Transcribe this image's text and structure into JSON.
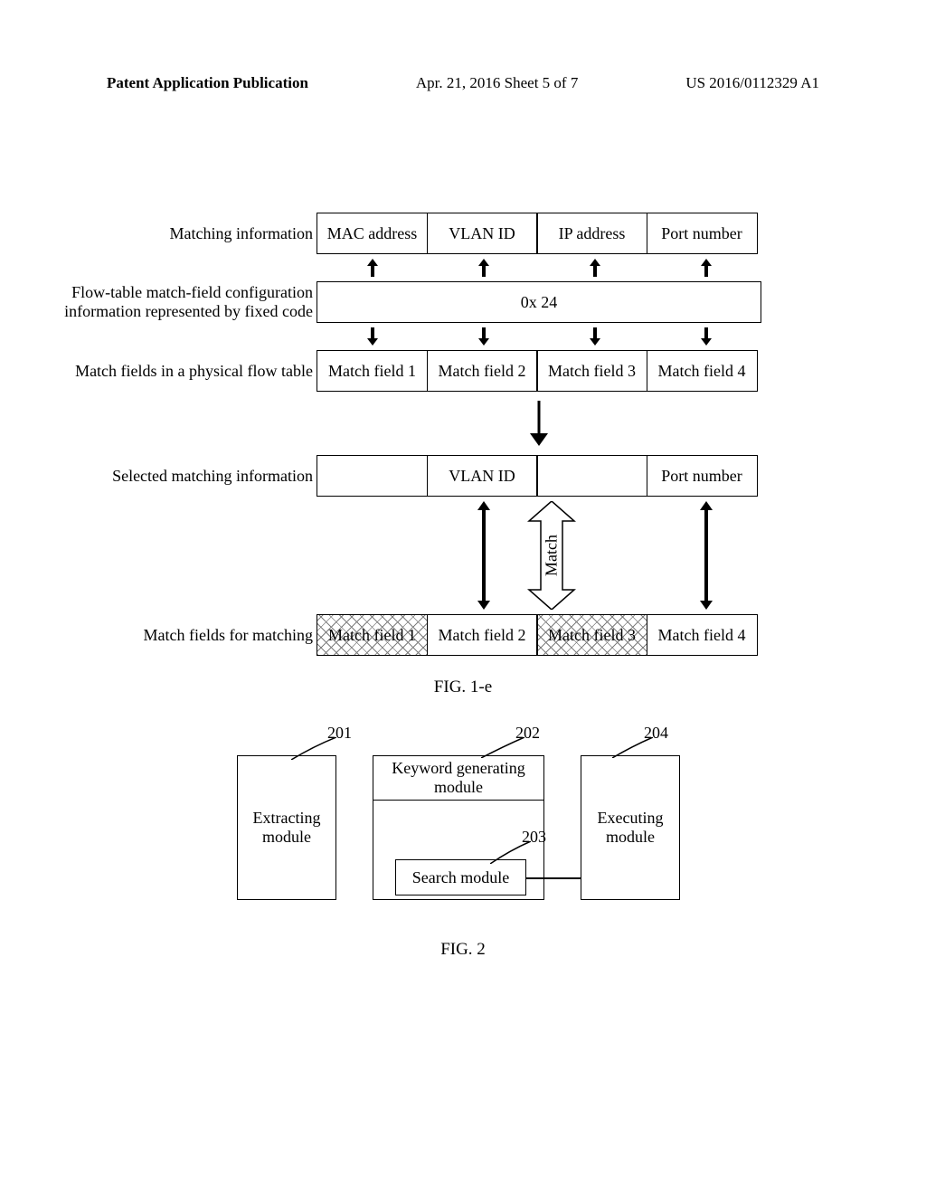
{
  "header": {
    "left": "Patent Application Publication",
    "center": "Apr. 21, 2016  Sheet 5 of 7",
    "right": "US 2016/0112329 A1"
  },
  "fig1e": {
    "labels": {
      "matching_info": "Matching information",
      "config_info": "Flow-table match-field configuration information represented by fixed code",
      "physical": "Match fields in a physical flow table",
      "selected": "Selected matching information",
      "for_matching": "Match fields for matching",
      "match": "Match"
    },
    "matching_info": [
      "MAC address",
      "VLAN ID",
      "IP address",
      "Port number"
    ],
    "config_value": "0x 24",
    "physical_fields": [
      "Match field 1",
      "Match field 2",
      "Match field 3",
      "Match field 4"
    ],
    "selected_info": [
      "",
      "VLAN ID",
      "",
      "Port number"
    ],
    "for_matching_fields": [
      "Match field 1",
      "Match field 2",
      "Match field 3",
      "Match field 4"
    ],
    "caption": "FIG. 1-e"
  },
  "fig2": {
    "callouts": {
      "c1": "201",
      "c2": "202",
      "c3": "203",
      "c4": "204"
    },
    "boxes": {
      "extracting": "Extracting module",
      "keyword": "Keyword generating module",
      "search": "Search module",
      "executing": "Executing module"
    },
    "caption": "FIG. 2"
  }
}
